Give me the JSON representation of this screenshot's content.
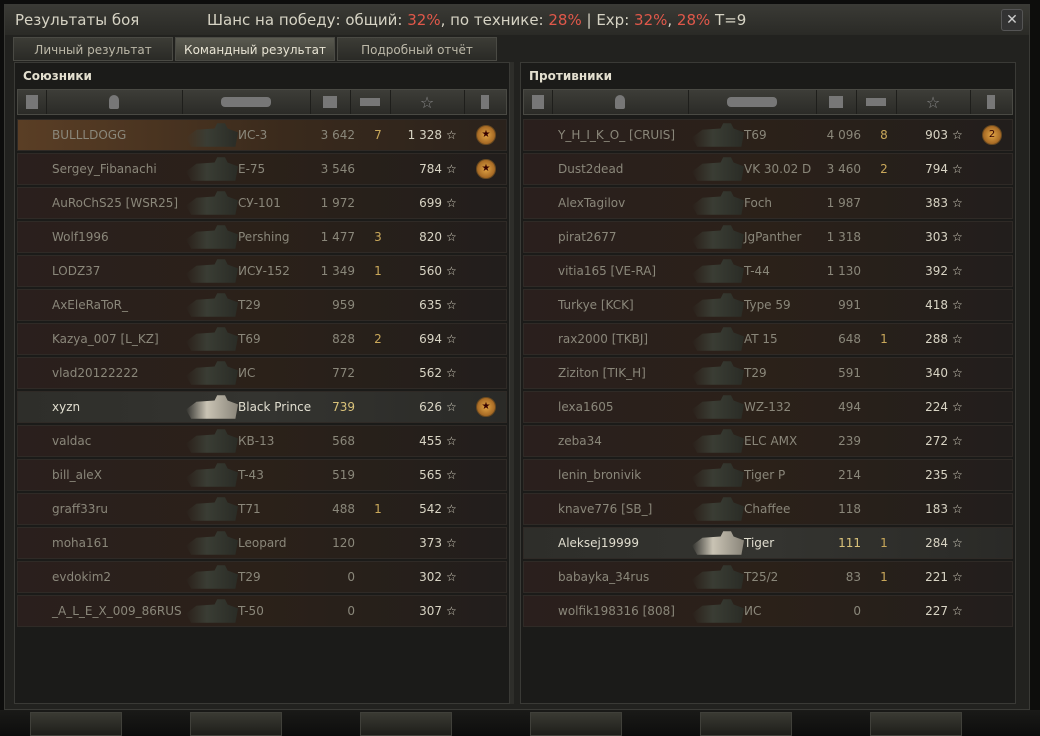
{
  "window": {
    "title": "Результаты боя",
    "chance": {
      "prefix": "Шанс на победу: общий: ",
      "overall": "32%",
      "tech_label": ", по технике: ",
      "tech": "28%",
      "sep": " | Exp: ",
      "exp1": "32%",
      "comma": ", ",
      "exp2": "28%",
      "tier": " T=9"
    },
    "close_label": "✕"
  },
  "tabs": [
    {
      "label": "Личный результат",
      "active": false
    },
    {
      "label": "Командный результат",
      "active": true
    },
    {
      "label": "Подробный отчёт",
      "active": false
    }
  ],
  "allies": {
    "title": "Союзники",
    "rows": [
      {
        "player": "BULLLDOGG",
        "tank": "ИС-3",
        "damage": "3 642",
        "kills": "7",
        "xp": "1 328",
        "medal": true,
        "style": "me"
      },
      {
        "player": "Sergey_Fibanachi",
        "tank": "E-75",
        "damage": "3 546",
        "kills": "",
        "xp": "784",
        "medal": true,
        "style": ""
      },
      {
        "player": "AuRoChS25 [WSR25]",
        "tank": "СУ-101",
        "damage": "1 972",
        "kills": "",
        "xp": "699",
        "medal": false,
        "style": ""
      },
      {
        "player": "Wolf1996",
        "tank": "Pershing",
        "damage": "1 477",
        "kills": "3",
        "xp": "820",
        "medal": false,
        "style": ""
      },
      {
        "player": "LODZ37",
        "tank": "ИСУ-152",
        "damage": "1 349",
        "kills": "1",
        "xp": "560",
        "medal": false,
        "style": ""
      },
      {
        "player": "AxEleRaToR_",
        "tank": "T29",
        "damage": "959",
        "kills": "",
        "xp": "635",
        "medal": false,
        "style": ""
      },
      {
        "player": "Kazya_007 [L_KZ]",
        "tank": "T69",
        "damage": "828",
        "kills": "2",
        "xp": "694",
        "medal": false,
        "style": ""
      },
      {
        "player": "vlad20122222",
        "tank": "ИС",
        "damage": "772",
        "kills": "",
        "xp": "562",
        "medal": false,
        "style": ""
      },
      {
        "player": "xyzn",
        "tank": "Black Prince",
        "damage": "739",
        "kills": "",
        "xp": "626",
        "medal": true,
        "style": "hl bright light"
      },
      {
        "player": "valdac",
        "tank": "КВ-13",
        "damage": "568",
        "kills": "",
        "xp": "455",
        "medal": false,
        "style": ""
      },
      {
        "player": "bill_aleX",
        "tank": "T-43",
        "damage": "519",
        "kills": "",
        "xp": "565",
        "medal": false,
        "style": ""
      },
      {
        "player": "graff33ru",
        "tank": "T71",
        "damage": "488",
        "kills": "1",
        "xp": "542",
        "medal": false,
        "style": ""
      },
      {
        "player": "moha161",
        "tank": "Leopard",
        "damage": "120",
        "kills": "",
        "xp": "373",
        "medal": false,
        "style": ""
      },
      {
        "player": "evdokim2",
        "tank": "T29",
        "damage": "0",
        "kills": "",
        "xp": "302",
        "medal": false,
        "style": ""
      },
      {
        "player": "_A_L_E_X_009_86RUS",
        "tank": "T-50",
        "damage": "0",
        "kills": "",
        "xp": "307",
        "medal": false,
        "style": ""
      }
    ]
  },
  "enemies": {
    "title": "Противники",
    "rows": [
      {
        "player": "Y_H_I_K_O_ [CRUIS]",
        "tank": "T69",
        "damage": "4 096",
        "kills": "8",
        "xp": "903",
        "medal": true,
        "medal_count": "2",
        "style": ""
      },
      {
        "player": "Dust2dead",
        "tank": "VK 30.02 D",
        "damage": "3 460",
        "kills": "2",
        "xp": "794",
        "medal": false,
        "style": ""
      },
      {
        "player": "AlexTagilov",
        "tank": "Foch",
        "damage": "1 987",
        "kills": "",
        "xp": "383",
        "medal": false,
        "style": ""
      },
      {
        "player": "pirat2677",
        "tank": "JgPanther",
        "damage": "1 318",
        "kills": "",
        "xp": "303",
        "medal": false,
        "style": ""
      },
      {
        "player": "vitia165 [VE-RA]",
        "tank": "T-44",
        "damage": "1 130",
        "kills": "",
        "xp": "392",
        "medal": false,
        "style": ""
      },
      {
        "player": "Turkye [KCK]",
        "tank": "Type 59",
        "damage": "991",
        "kills": "",
        "xp": "418",
        "medal": false,
        "style": ""
      },
      {
        "player": "rax2000 [TKBJ]",
        "tank": "AT 15",
        "damage": "648",
        "kills": "1",
        "xp": "288",
        "medal": false,
        "style": ""
      },
      {
        "player": "Ziziton [TIK_H]",
        "tank": "T29",
        "damage": "591",
        "kills": "",
        "xp": "340",
        "medal": false,
        "style": ""
      },
      {
        "player": "lexa1605",
        "tank": "WZ-132",
        "damage": "494",
        "kills": "",
        "xp": "224",
        "medal": false,
        "style": ""
      },
      {
        "player": "zeba34",
        "tank": "ELC AMX",
        "damage": "239",
        "kills": "",
        "xp": "272",
        "medal": false,
        "style": ""
      },
      {
        "player": "lenin_bronivik",
        "tank": "Tiger P",
        "damage": "214",
        "kills": "",
        "xp": "235",
        "medal": false,
        "style": ""
      },
      {
        "player": "knave776 [SB_]",
        "tank": "Chaffee",
        "damage": "118",
        "kills": "",
        "xp": "183",
        "medal": false,
        "style": ""
      },
      {
        "player": "Aleksej19999",
        "tank": "Tiger",
        "damage": "111",
        "kills": "1",
        "xp": "284",
        "medal": false,
        "style": "hl bright light"
      },
      {
        "player": "babayka_34rus",
        "tank": "T25/2",
        "damage": "83",
        "kills": "1",
        "xp": "221",
        "medal": false,
        "style": ""
      },
      {
        "player": "wolfik198316 [808]",
        "tank": "ИС",
        "damage": "0",
        "kills": "",
        "xp": "227",
        "medal": false,
        "style": ""
      }
    ]
  },
  "columns": {
    "icons": [
      "squad-icon",
      "player-icon",
      "tank-icon",
      "damage-icon",
      "kills-icon",
      "xp-star-icon",
      "medal-icon"
    ]
  },
  "star_glyph": "☆"
}
